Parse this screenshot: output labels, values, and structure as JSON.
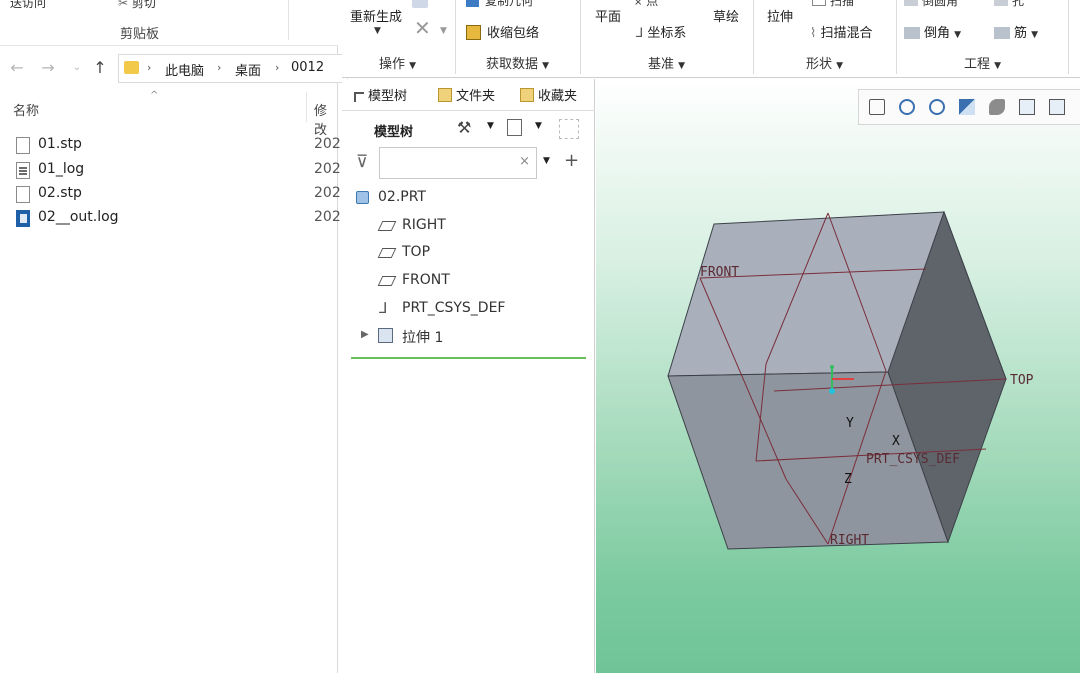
{
  "explorer": {
    "ribbon": {
      "cut_left": "送访问",
      "cut_right": "剪切",
      "group_label": "剪贴板"
    },
    "nav": {
      "back_icon": "arrow-left-icon",
      "forward_icon": "arrow-right-icon",
      "up_icon": "arrow-up-icon"
    },
    "breadcrumb": [
      "此电脑",
      "桌面",
      "0012"
    ],
    "columns": {
      "name": "名称",
      "modified": "修改"
    },
    "files": [
      {
        "name": "01.stp",
        "date": "202",
        "icon": "file-icon"
      },
      {
        "name": "01_log",
        "date": "202",
        "icon": "log-file-icon"
      },
      {
        "name": "02.stp",
        "date": "202",
        "icon": "file-icon"
      },
      {
        "name": "02__out.log",
        "date": "202",
        "icon": "out-log-file-icon"
      }
    ]
  },
  "ribbon": {
    "cut_top": {
      "copy_geom": "复制几何",
      "point": "点",
      "sweep": "扫描",
      "round": "倒圆角",
      "hole": "孔"
    },
    "regenerate": "重新生成",
    "shrinkwrap": "收缩包络",
    "plane": "平面",
    "csys": "坐标系",
    "sketch": "草绘",
    "extrude": "拉伸",
    "swept_blend": "扫描混合",
    "chamfer": "倒角",
    "rib": "筋",
    "groups": {
      "operations": "操作",
      "get_data": "获取数据",
      "datum": "基准",
      "shapes": "形状",
      "engineering": "工程"
    }
  },
  "panel": {
    "tabs": [
      "模型树",
      "文件夹",
      "收藏夹"
    ],
    "tree_title": "模型树",
    "filter_placeholder": "",
    "tree": [
      {
        "label": "02.PRT",
        "icon": "part-icon",
        "level": 0
      },
      {
        "label": "RIGHT",
        "icon": "datum-plane-icon",
        "level": 1
      },
      {
        "label": "TOP",
        "icon": "datum-plane-icon",
        "level": 1
      },
      {
        "label": "FRONT",
        "icon": "datum-plane-icon",
        "level": 1
      },
      {
        "label": "PRT_CSYS_DEF",
        "icon": "csys-icon",
        "level": 1
      },
      {
        "label": "拉伸 1",
        "icon": "extrude-feature-icon",
        "level": 1
      }
    ]
  },
  "viewport": {
    "labels": {
      "front": "FRONT",
      "top": "TOP",
      "right": "RIGHT",
      "csys": "PRT_CSYS_DEF",
      "axis_x": "X",
      "axis_y": "Y",
      "axis_z": "Z"
    },
    "colors": {
      "top_face": "#a9b0bc",
      "front_face": "#8f959e",
      "side_face": "#5f646b",
      "datum_line": "#7a2e3a"
    }
  }
}
